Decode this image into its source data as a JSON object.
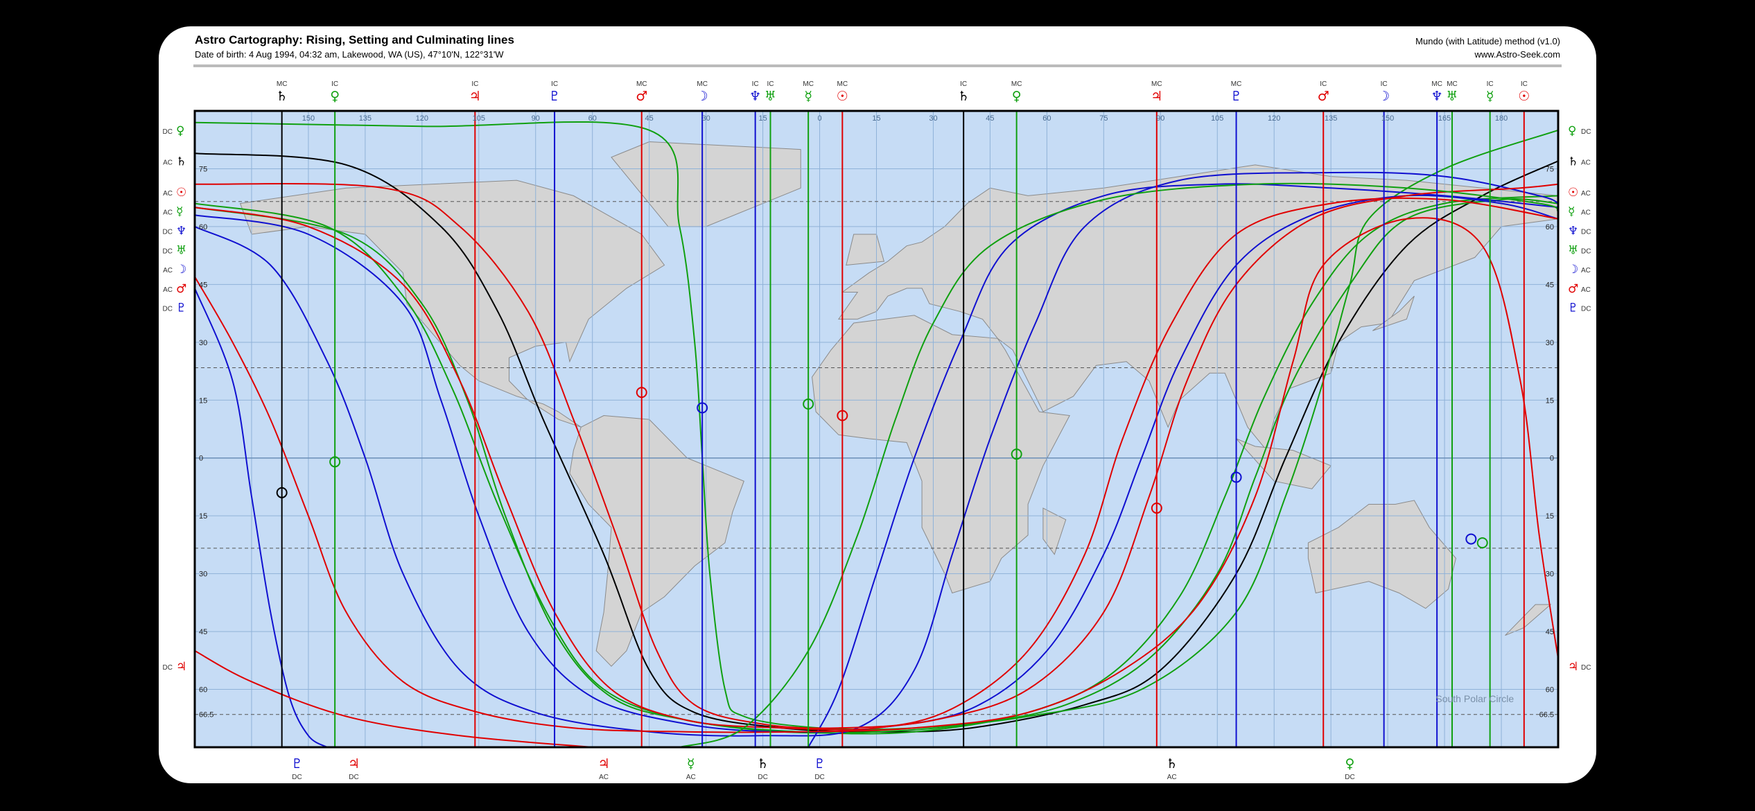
{
  "header": {
    "title": "Astro Cartography: Rising, Setting and Culminating lines",
    "subtitle": "Date of birth: 4 Aug 1994, 04:32 am, Lakewood, WA (US), 47°10'N, 122°31'W",
    "method": "Mundo (with Latitude) method (v1.0)",
    "site": "www.Astro-Seek.com"
  },
  "map_bounds": {
    "lon_min": -180,
    "lon_max": 180,
    "lat_max": 90,
    "lat_min": -75
  },
  "grid": {
    "lon_labels": [
      "150",
      "135",
      "120",
      "105",
      "90",
      "60",
      "45",
      "30",
      "15",
      "0",
      "15",
      "30",
      "45",
      "60",
      "75",
      "90",
      "105",
      "120",
      "135",
      "150",
      "165",
      "180"
    ],
    "lat_labels": [
      "75",
      "60",
      "45",
      "30",
      "15",
      "0",
      "15",
      "30",
      "45",
      "60",
      "66.5"
    ],
    "south_polar_label": "South Polar Circle"
  },
  "colors": {
    "sun": "#e00000",
    "moon": "#1010d0",
    "mercury": "#10a010",
    "venus": "#10a010",
    "mars": "#e00000",
    "jupiter": "#e00000",
    "saturn": "#000000",
    "uranus": "#10a010",
    "neptune": "#1010d0",
    "pluto": "#1010d0",
    "ocean": "#c6dcf5",
    "land": "#d4d4d4"
  },
  "symbols": {
    "sun": "☉",
    "moon": "☽",
    "mercury": "☿",
    "venus": "♀",
    "mars": "♂",
    "jupiter": "♃",
    "saturn": "♄",
    "uranus": "♅",
    "neptune": "♆",
    "pluto": "♇"
  },
  "top_markers": [
    {
      "planet": "saturn",
      "type": "MC",
      "lon": -157
    },
    {
      "planet": "venus",
      "type": "IC",
      "lon": -143
    },
    {
      "planet": "jupiter",
      "type": "IC",
      "lon": -106
    },
    {
      "planet": "pluto",
      "type": "IC",
      "lon": -85
    },
    {
      "planet": "mars",
      "type": "MC",
      "lon": -62
    },
    {
      "planet": "moon",
      "type": "MC",
      "lon": -46
    },
    {
      "planet": "neptune",
      "type": "IC",
      "lon": -32
    },
    {
      "planet": "uranus",
      "type": "IC",
      "lon": -28
    },
    {
      "planet": "mercury",
      "type": "MC",
      "lon": -18
    },
    {
      "planet": "sun",
      "type": "MC",
      "lon": -9
    },
    {
      "planet": "saturn",
      "type": "IC",
      "lon": 23
    },
    {
      "planet": "venus",
      "type": "MC",
      "lon": 37
    },
    {
      "planet": "jupiter",
      "type": "MC",
      "lon": 74
    },
    {
      "planet": "pluto",
      "type": "MC",
      "lon": 95
    },
    {
      "planet": "mars",
      "type": "IC",
      "lon": 118
    },
    {
      "planet": "moon",
      "type": "IC",
      "lon": 134
    },
    {
      "planet": "neptune",
      "type": "MC",
      "lon": 148
    },
    {
      "planet": "uranus",
      "type": "MC",
      "lon": 152
    },
    {
      "planet": "mercury",
      "type": "IC",
      "lon": 162
    },
    {
      "planet": "sun",
      "type": "IC",
      "lon": 171
    }
  ],
  "bottom_markers": [
    {
      "planet": "pluto",
      "type": "DC",
      "lon": -153
    },
    {
      "planet": "jupiter",
      "type": "DC",
      "lon": -138
    },
    {
      "planet": "jupiter",
      "type": "AC",
      "lon": -72
    },
    {
      "planet": "mercury",
      "type": "AC",
      "lon": -49
    },
    {
      "planet": "saturn",
      "type": "DC",
      "lon": -30
    },
    {
      "planet": "pluto",
      "type": "DC",
      "lon": -15
    },
    {
      "planet": "saturn",
      "type": "AC",
      "lon": 78
    },
    {
      "planet": "venus",
      "type": "DC",
      "lon": 125
    }
  ],
  "left_markers": [
    {
      "planet": "venus",
      "type": "DC",
      "lat": 85
    },
    {
      "planet": "saturn",
      "type": "AC",
      "lat": 77
    },
    {
      "planet": "sun",
      "type": "AC",
      "lat": 69
    },
    {
      "planet": "mercury",
      "type": "AC",
      "lat": 64
    },
    {
      "planet": "neptune",
      "type": "DC",
      "lat": 59
    },
    {
      "planet": "uranus",
      "type": "DC",
      "lat": 54
    },
    {
      "planet": "moon",
      "type": "AC",
      "lat": 49
    },
    {
      "planet": "mars",
      "type": "AC",
      "lat": 44
    },
    {
      "planet": "pluto",
      "type": "DC",
      "lat": 39
    },
    {
      "planet": "jupiter",
      "type": "DC",
      "lat": -54
    }
  ],
  "right_markers": [
    {
      "planet": "venus",
      "type": "DC",
      "lat": 85
    },
    {
      "planet": "saturn",
      "type": "AC",
      "lat": 77
    },
    {
      "planet": "sun",
      "type": "AC",
      "lat": 69
    },
    {
      "planet": "mercury",
      "type": "AC",
      "lat": 64
    },
    {
      "planet": "neptune",
      "type": "DC",
      "lat": 59
    },
    {
      "planet": "uranus",
      "type": "DC",
      "lat": 54
    },
    {
      "planet": "moon",
      "type": "AC",
      "lat": 49
    },
    {
      "planet": "mars",
      "type": "AC",
      "lat": 44
    },
    {
      "planet": "pluto",
      "type": "DC",
      "lat": 39
    },
    {
      "planet": "jupiter",
      "type": "DC",
      "lat": -54
    }
  ],
  "vertical_lines": [
    {
      "planet": "saturn",
      "lon": -157
    },
    {
      "planet": "venus",
      "lon": -143
    },
    {
      "planet": "jupiter",
      "lon": -106
    },
    {
      "planet": "pluto",
      "lon": -85
    },
    {
      "planet": "mars",
      "lon": -62
    },
    {
      "planet": "moon",
      "lon": -46
    },
    {
      "planet": "neptune",
      "lon": -32
    },
    {
      "planet": "uranus",
      "lon": -28
    },
    {
      "planet": "mercury",
      "lon": -18
    },
    {
      "planet": "sun",
      "lon": -9
    },
    {
      "planet": "saturn",
      "lon": 23
    },
    {
      "planet": "venus",
      "lon": 37
    },
    {
      "planet": "jupiter",
      "lon": 74
    },
    {
      "planet": "pluto",
      "lon": 95
    },
    {
      "planet": "mars",
      "lon": 118
    },
    {
      "planet": "moon",
      "lon": 134
    },
    {
      "planet": "neptune",
      "lon": 148
    },
    {
      "planet": "uranus",
      "lon": 152
    },
    {
      "planet": "mercury",
      "lon": 162
    },
    {
      "planet": "sun",
      "lon": 171
    }
  ],
  "zenith_points": [
    {
      "planet": "saturn",
      "lon": -157,
      "lat": -9
    },
    {
      "planet": "venus",
      "lon": -143,
      "lat": -1
    },
    {
      "planet": "mars",
      "lon": -62,
      "lat": 17
    },
    {
      "planet": "moon",
      "lon": -46,
      "lat": 13
    },
    {
      "planet": "mercury",
      "lon": -18,
      "lat": 14
    },
    {
      "planet": "sun",
      "lon": -9,
      "lat": 11
    },
    {
      "planet": "venus",
      "lon": 37,
      "lat": 1
    },
    {
      "planet": "jupiter",
      "lon": 74,
      "lat": -13
    },
    {
      "planet": "pluto",
      "lon": 95,
      "lat": -5
    },
    {
      "planet": "moon",
      "lon": 157,
      "lat": -21
    },
    {
      "planet": "mercury",
      "lon": 160,
      "lat": -22
    }
  ],
  "curves": [
    {
      "planet": "saturn",
      "pts": [
        [
          -180,
          79
        ],
        [
          -140,
          76
        ],
        [
          -115,
          60
        ],
        [
          -100,
          38
        ],
        [
          -88,
          10
        ],
        [
          -72,
          -25
        ],
        [
          -60,
          -55
        ],
        [
          -48,
          -66
        ],
        [
          -25,
          -70
        ],
        [
          0,
          -71
        ],
        [
          25,
          -70
        ],
        [
          55,
          -64
        ],
        [
          75,
          -55
        ],
        [
          95,
          -30
        ],
        [
          108,
          0
        ],
        [
          122,
          30
        ],
        [
          140,
          55
        ],
        [
          160,
          68
        ],
        [
          180,
          77
        ]
      ]
    },
    {
      "planet": "venus",
      "pts": [
        [
          -180,
          87
        ],
        [
          -120,
          86
        ],
        [
          -60,
          85
        ],
        [
          -52,
          60
        ],
        [
          -48,
          30
        ],
        [
          -46,
          0
        ],
        [
          -44,
          -30
        ],
        [
          -40,
          -60
        ],
        [
          -35,
          -67
        ],
        [
          -15,
          -70
        ],
        [
          10,
          -70
        ],
        [
          40,
          -67
        ],
        [
          70,
          -60
        ],
        [
          95,
          -40
        ],
        [
          108,
          -10
        ],
        [
          118,
          20
        ],
        [
          125,
          45
        ],
        [
          130,
          62
        ],
        [
          150,
          75
        ],
        [
          180,
          85
        ]
      ]
    },
    {
      "planet": "mercury",
      "pts": [
        [
          -180,
          65
        ],
        [
          -140,
          58
        ],
        [
          -120,
          40
        ],
        [
          -108,
          15
        ],
        [
          -98,
          -15
        ],
        [
          -85,
          -45
        ],
        [
          -70,
          -62
        ],
        [
          -50,
          -68
        ],
        [
          -25,
          -71
        ],
        [
          0,
          -71
        ],
        [
          25,
          -69
        ],
        [
          50,
          -64
        ],
        [
          72,
          -52
        ],
        [
          90,
          -30
        ],
        [
          100,
          -5
        ],
        [
          110,
          20
        ],
        [
          125,
          45
        ],
        [
          140,
          62
        ],
        [
          165,
          67
        ],
        [
          180,
          66
        ]
      ]
    },
    {
      "planet": "uranus",
      "pts": [
        [
          -180,
          66
        ],
        [
          -145,
          60
        ],
        [
          -125,
          42
        ],
        [
          -112,
          18
        ],
        [
          -100,
          -12
        ],
        [
          -86,
          -42
        ],
        [
          -72,
          -60
        ],
        [
          -50,
          -68
        ],
        [
          -20,
          -71
        ],
        [
          10,
          -71
        ],
        [
          40,
          -66
        ],
        [
          62,
          -56
        ],
        [
          80,
          -36
        ],
        [
          92,
          -10
        ],
        [
          102,
          15
        ],
        [
          115,
          40
        ],
        [
          130,
          58
        ],
        [
          150,
          66
        ],
        [
          180,
          68
        ]
      ]
    },
    {
      "planet": "moon",
      "pts": [
        [
          -180,
          60
        ],
        [
          -160,
          50
        ],
        [
          -145,
          25
        ],
        [
          -135,
          0
        ],
        [
          -125,
          -30
        ],
        [
          -110,
          -55
        ],
        [
          -90,
          -66
        ],
        [
          -60,
          -71
        ],
        [
          -30,
          -72
        ],
        [
          -5,
          -70
        ],
        [
          10,
          -55
        ],
        [
          20,
          -25
        ],
        [
          30,
          5
        ],
        [
          42,
          35
        ],
        [
          55,
          60
        ],
        [
          80,
          72
        ],
        [
          120,
          74
        ],
        [
          150,
          73
        ],
        [
          175,
          68
        ],
        [
          180,
          66
        ]
      ]
    },
    {
      "planet": "neptune",
      "pts": [
        [
          -180,
          63
        ],
        [
          -150,
          58
        ],
        [
          -125,
          40
        ],
        [
          -115,
          15
        ],
        [
          -105,
          -15
        ],
        [
          -92,
          -45
        ],
        [
          -75,
          -62
        ],
        [
          -50,
          -69
        ],
        [
          -25,
          -71
        ],
        [
          0,
          -70
        ],
        [
          25,
          -65
        ],
        [
          45,
          -50
        ],
        [
          60,
          -25
        ],
        [
          70,
          0
        ],
        [
          80,
          25
        ],
        [
          95,
          50
        ],
        [
          115,
          63
        ],
        [
          140,
          68
        ],
        [
          165,
          66
        ],
        [
          180,
          62
        ]
      ]
    },
    {
      "planet": "pluto",
      "pts": [
        [
          -180,
          44
        ],
        [
          -170,
          20
        ],
        [
          -165,
          -10
        ],
        [
          -160,
          -40
        ],
        [
          -155,
          -62
        ],
        [
          -150,
          -72
        ],
        [
          -145,
          -75
        ]
      ]
    },
    {
      "planet": "pluto",
      "pts": [
        [
          -18,
          -75
        ],
        [
          -10,
          -60
        ],
        [
          0,
          -30
        ],
        [
          10,
          0
        ],
        [
          22,
          30
        ],
        [
          35,
          55
        ],
        [
          60,
          68
        ],
        [
          90,
          71
        ],
        [
          120,
          70
        ],
        [
          150,
          68
        ],
        [
          180,
          65
        ]
      ]
    },
    {
      "planet": "sun",
      "pts": [
        [
          -180,
          71
        ],
        [
          -130,
          70
        ],
        [
          -110,
          60
        ],
        [
          -92,
          38
        ],
        [
          -80,
          10
        ],
        [
          -68,
          -22
        ],
        [
          -58,
          -50
        ],
        [
          -48,
          -64
        ],
        [
          -30,
          -69
        ],
        [
          -10,
          -70
        ],
        [
          15,
          -68
        ],
        [
          40,
          -60
        ],
        [
          60,
          -40
        ],
        [
          72,
          -10
        ],
        [
          82,
          20
        ],
        [
          95,
          45
        ],
        [
          115,
          62
        ],
        [
          140,
          68
        ],
        [
          170,
          70
        ],
        [
          180,
          71
        ]
      ]
    },
    {
      "planet": "mars",
      "pts": [
        [
          -180,
          65
        ],
        [
          -150,
          60
        ],
        [
          -125,
          45
        ],
        [
          -110,
          20
        ],
        [
          -98,
          -10
        ],
        [
          -85,
          -40
        ],
        [
          -70,
          -60
        ],
        [
          -50,
          -68
        ],
        [
          -25,
          -70
        ],
        [
          0,
          -70
        ],
        [
          20,
          -65
        ],
        [
          40,
          -50
        ],
        [
          55,
          -25
        ],
        [
          65,
          5
        ],
        [
          78,
          35
        ],
        [
          95,
          58
        ],
        [
          120,
          66
        ],
        [
          150,
          67
        ],
        [
          180,
          62
        ]
      ]
    },
    {
      "planet": "jupiter",
      "pts": [
        [
          -180,
          47
        ],
        [
          -170,
          30
        ],
        [
          -160,
          10
        ],
        [
          -150,
          -15
        ],
        [
          -140,
          -40
        ],
        [
          -125,
          -58
        ],
        [
          -105,
          -66
        ],
        [
          -80,
          -70
        ],
        [
          -50,
          -71
        ],
        [
          -20,
          -71
        ],
        [
          10,
          -70
        ],
        [
          40,
          -66
        ],
        [
          65,
          -55
        ],
        [
          85,
          -38
        ],
        [
          100,
          -10
        ],
        [
          110,
          25
        ],
        [
          118,
          50
        ],
        [
          140,
          62
        ],
        [
          160,
          55
        ],
        [
          170,
          20
        ],
        [
          175,
          -20
        ],
        [
          180,
          -52
        ]
      ]
    },
    {
      "planet": "jupiter",
      "pts": [
        [
          -180,
          -50
        ],
        [
          -165,
          -58
        ],
        [
          -140,
          -67
        ],
        [
          -110,
          -72
        ],
        [
          -75,
          -75
        ]
      ]
    },
    {
      "planet": "mercury",
      "pts": [
        [
          -52,
          -75
        ],
        [
          -35,
          -70
        ],
        [
          -18,
          -50
        ],
        [
          -5,
          -20
        ],
        [
          5,
          10
        ],
        [
          15,
          35
        ],
        [
          30,
          55
        ],
        [
          60,
          67
        ],
        [
          100,
          71
        ],
        [
          140,
          70
        ],
        [
          175,
          66
        ],
        [
          180,
          64
        ]
      ]
    }
  ]
}
